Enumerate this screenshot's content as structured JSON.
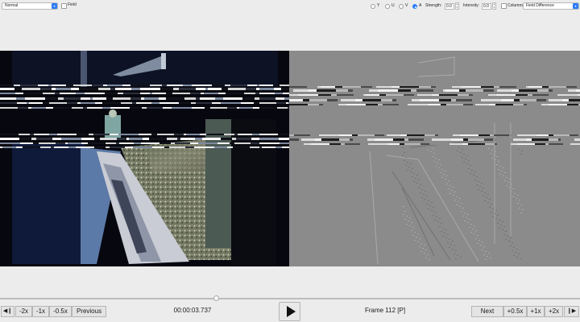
{
  "toolbar": {
    "mode_select": "Normal",
    "field_label": "Field",
    "channels": [
      {
        "label": "Y",
        "selected": false
      },
      {
        "label": "U",
        "selected": false
      },
      {
        "label": "V",
        "selected": false
      },
      {
        "label": "A",
        "selected": true
      }
    ],
    "strength_label": "Strength:",
    "strength_value": "0.0",
    "intensity_label": "Intensity:",
    "intensity_value": "0.0",
    "columns_label": "Columns",
    "view_select": "Field Difference"
  },
  "playback": {
    "timecode": "00:00:03.737",
    "frame_label": "Frame 112 [P]",
    "previous_label": "Previous",
    "next_label": "Next",
    "back_rates": [
      "-2x",
      "-1x",
      "-0.5x"
    ],
    "forward_rates": [
      "+0.5x",
      "+1x",
      "+2x"
    ]
  },
  "colors": {
    "accent": "#2f7cf6",
    "window_bg": "#ececec",
    "difference_gray": "#8b8b8b"
  }
}
